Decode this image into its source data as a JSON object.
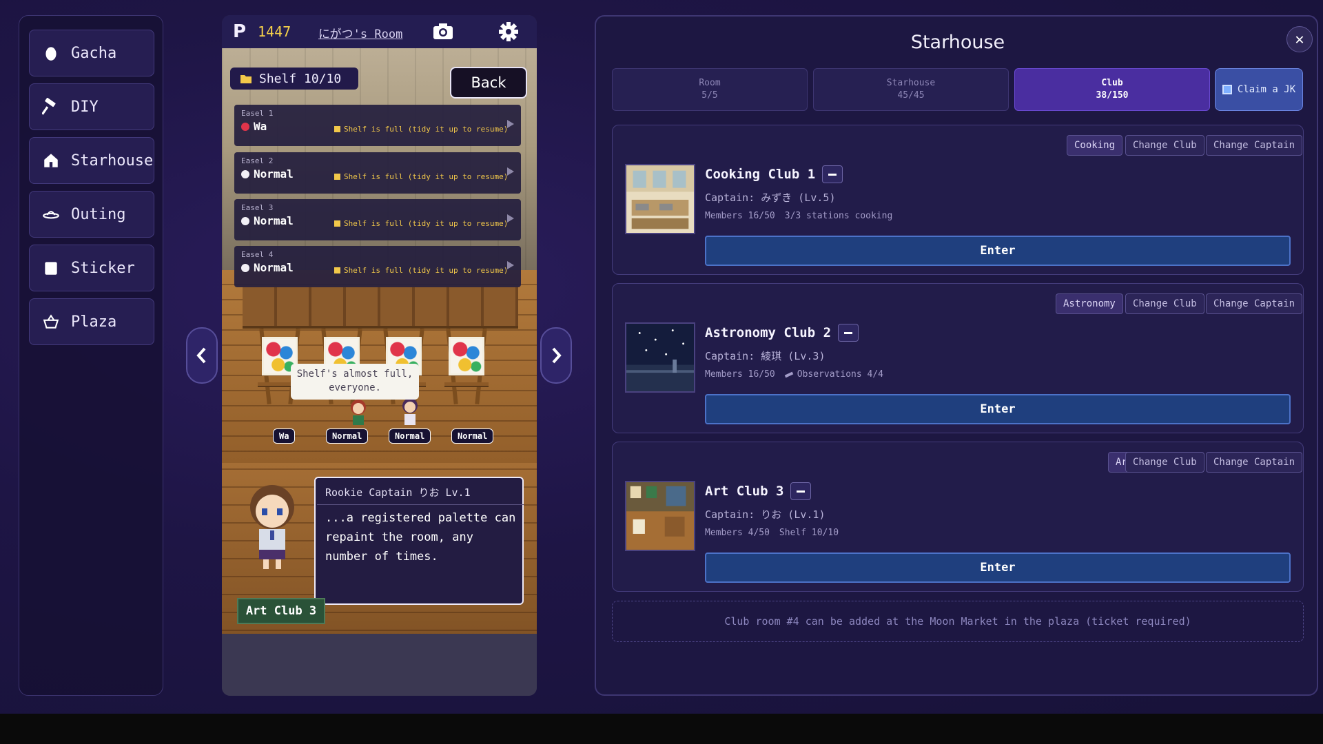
{
  "nav": {
    "items": [
      {
        "label": "Gacha",
        "icon": "egg-icon"
      },
      {
        "label": "DIY",
        "icon": "hammer-icon"
      },
      {
        "label": "Starhouse",
        "icon": "house-icon"
      },
      {
        "label": "Outing",
        "icon": "ufo-icon"
      },
      {
        "label": "Sticker",
        "icon": "sticker-icon"
      },
      {
        "label": "Plaza",
        "icon": "basket-icon"
      }
    ]
  },
  "game": {
    "hud": {
      "points": "1447",
      "room_name": "にがつ's Room"
    },
    "shelf_label": "Shelf 10/10",
    "back_label": "Back",
    "easels": [
      {
        "label": "Easel 1",
        "status": "Wa",
        "dot_color": "#e0344a",
        "message": "Shelf is full (tidy it up to resume)"
      },
      {
        "label": "Easel 2",
        "status": "Normal",
        "dot_color": "#f2f0f6",
        "message": "Shelf is full (tidy it up to resume)"
      },
      {
        "label": "Easel 3",
        "status": "Normal",
        "dot_color": "#f2f0f6",
        "message": "Shelf is full (tidy it up to resume)"
      },
      {
        "label": "Easel 4",
        "status": "Normal",
        "dot_color": "#f2f0f6",
        "message": "Shelf is full (tidy it up to resume)"
      }
    ],
    "easel_tags": [
      "Wa",
      "Normal",
      "Normal",
      "Normal"
    ],
    "bubble_text": "Shelf's almost full, everyone.",
    "dialog": {
      "speaker": "Rookie Captain りお Lv.1",
      "text": "...a registered palette can repaint the room, any number of times."
    },
    "room_label": "Art Club 3"
  },
  "panel": {
    "title": "Starhouse",
    "tabs": [
      {
        "label": "Room",
        "value": "5/5"
      },
      {
        "label": "Starhouse",
        "value": "45/45"
      },
      {
        "label": "Club",
        "value": "38/150"
      }
    ],
    "claim_label": "Claim a JK",
    "clubs": [
      {
        "name": "Cooking Club 1",
        "category": "Cooking",
        "change_club": "Change Club",
        "change_captain": "Change Captain",
        "captain": "Captain: みずき (Lv.5)",
        "members": "Members 16/50",
        "extra": "3/3 stations cooking",
        "enter": "Enter"
      },
      {
        "name": "Astronomy Club 2",
        "category": "Astronomy",
        "change_club": "Change Club",
        "change_captain": "Change Captain",
        "captain": "Captain: 綾琪 (Lv.3)",
        "members": "Members 16/50",
        "extra": "Observations 4/4",
        "enter": "Enter"
      },
      {
        "name": "Art Club 3",
        "category": "Art",
        "change_club": "Change Club",
        "change_captain": "Change Captain",
        "captain": "Captain: りお (Lv.1)",
        "members": "Members 4/50",
        "extra": "Shelf 10/10",
        "enter": "Enter"
      }
    ],
    "notice": "Club room #4 can be added at the Moon Market in the plaza (ticket required)"
  }
}
